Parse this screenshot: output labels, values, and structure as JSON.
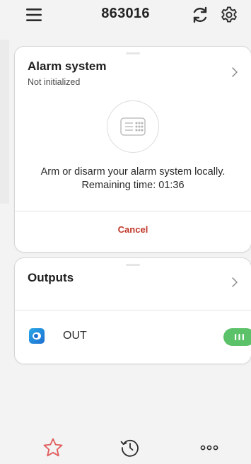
{
  "header": {
    "title": "863016",
    "menu_icon": "hamburger-menu-icon",
    "sync_icon": "sync-icon",
    "settings_icon": "gear-icon"
  },
  "alarm_card": {
    "title": "Alarm system",
    "status": "Not initialized",
    "icon": "keypad-icon",
    "message_line1": "Arm or disarm your alarm system locally.",
    "message_line2": "Remaining time: 01:36",
    "cancel_label": "Cancel"
  },
  "outputs_card": {
    "title": "Outputs",
    "items": [
      {
        "label": "OUT",
        "state": "on",
        "icon": "switch-icon"
      }
    ]
  },
  "bottom_nav": {
    "items": [
      {
        "icon": "star-icon",
        "active": true
      },
      {
        "icon": "history-icon",
        "active": false
      },
      {
        "icon": "more-icon",
        "active": false
      }
    ]
  },
  "colors": {
    "background": "#f3f3f3",
    "card": "#ffffff",
    "cancel": "#c0392b",
    "toggle_on": "#5cc26a",
    "star": "#e05a5a",
    "output_icon": "#1f6fd0"
  }
}
